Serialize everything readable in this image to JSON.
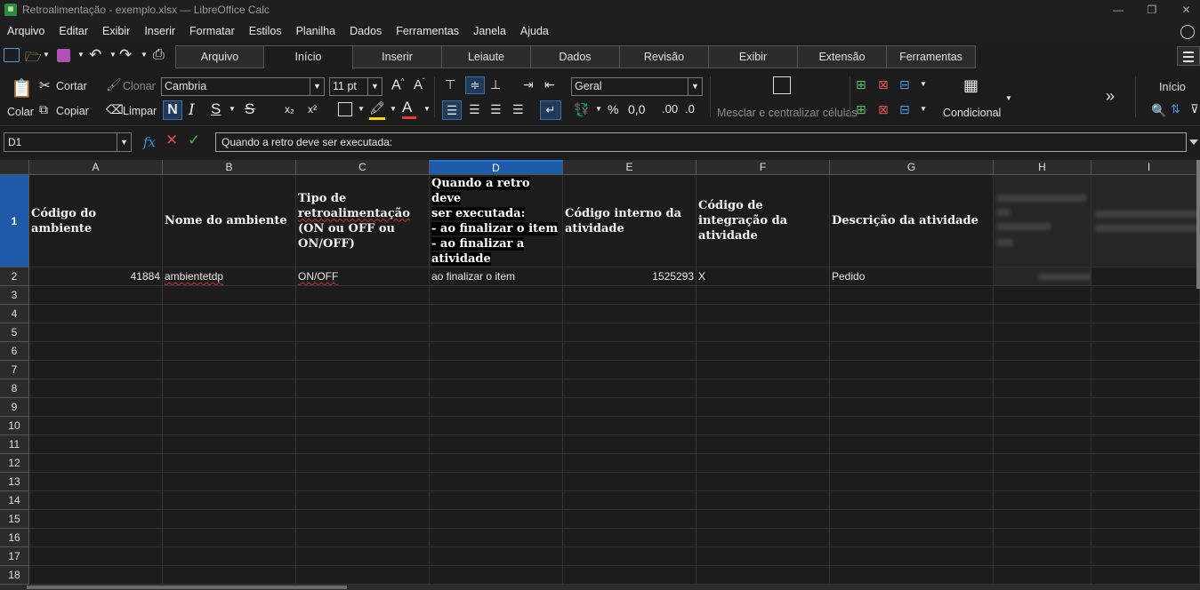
{
  "window": {
    "title": "Retroalimentação - exemplo.xlsx — LibreOffice Calc",
    "app_icon": "calc-icon",
    "controls": [
      "minimize-icon",
      "restore-icon",
      "close-icon"
    ]
  },
  "menu": [
    "Arquivo",
    "Editar",
    "Exibir",
    "Inserir",
    "Formatar",
    "Estilos",
    "Planilha",
    "Dados",
    "Ferramentas",
    "Janela",
    "Ajuda"
  ],
  "tabs": [
    {
      "label": "Arquivo",
      "active": false
    },
    {
      "label": "Início",
      "active": true
    },
    {
      "label": "Inserir",
      "active": false
    },
    {
      "label": "Leiaute",
      "active": false
    },
    {
      "label": "Dados",
      "active": false
    },
    {
      "label": "Revisão",
      "active": false
    },
    {
      "label": "Exibir",
      "active": false
    },
    {
      "label": "Extensão",
      "active": false
    },
    {
      "label": "Ferramentas",
      "active": false
    }
  ],
  "ribbon": {
    "paste_label": "Colar",
    "cut_label": "Cortar",
    "copy_label": "Copiar",
    "clone_label": "Clonar",
    "clear_label": "Limpar",
    "font_name": "Cambria",
    "font_size": "11 pt",
    "number_format": "Geral",
    "percent_symbol": "%",
    "decimal_text": "0,0",
    "decimal_add": ".00",
    "decimal_remove": ".0",
    "merge_label": "Mesclar e centralizar células",
    "conditional_label": "Condicional",
    "more_label": "»",
    "home_label": "Início",
    "bold": "N",
    "italic": "I",
    "underline": "S",
    "strike": "S",
    "subscript": "x₂",
    "superscript": "x²"
  },
  "formula_bar": {
    "cell_ref": "D1",
    "fx": "fx",
    "formula": "Quando a retro deve ser executada:"
  },
  "sheet": {
    "columns": [
      "A",
      "B",
      "C",
      "D",
      "E",
      "F",
      "G",
      "H",
      "I"
    ],
    "selected_column": "D",
    "rows": [
      "1",
      "2",
      "3",
      "4",
      "5",
      "6",
      "7",
      "8",
      "9",
      "10",
      "11",
      "12",
      "13",
      "14",
      "15",
      "16",
      "17",
      "18"
    ],
    "header": {
      "a": "Código do ambiente",
      "b": "Nome do ambiente",
      "c1": "Tipo de",
      "c2": "retroalimentação",
      "c3": "(ON ou OFF ou",
      "c4": "ON/OFF)",
      "d1": "Quando a retro deve",
      "d2": "ser executada:",
      "d3": "- ao finalizar o item",
      "d4": "- ao finalizar a",
      "d5": "atividade",
      "e": "Código interno da atividade",
      "f": "Código de integração da atividade",
      "g": "Descrição da atividade"
    },
    "row2": {
      "a": "41884",
      "b": "ambientetdp",
      "c": "ON/OFF",
      "d": "ao finalizar o item",
      "e": "1525293",
      "f": "X",
      "g": "Pedido"
    }
  }
}
